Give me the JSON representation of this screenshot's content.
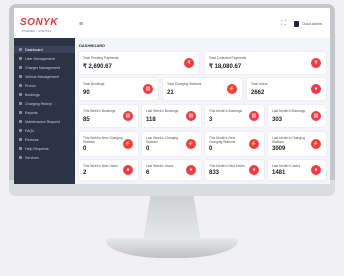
{
  "app": {
    "logo": "SONYK",
    "logo_sub": "POWER · DIGITAL",
    "user_menu": "Cloud Admin"
  },
  "sidebar": {
    "items": [
      {
        "label": "Dashboard",
        "active": true
      },
      {
        "label": "User Management"
      },
      {
        "label": "Charger Management"
      },
      {
        "label": "Vehicle Management"
      },
      {
        "label": "Promo"
      },
      {
        "label": "Bookings"
      },
      {
        "label": "Charging History"
      },
      {
        "label": "Reports"
      },
      {
        "label": "Maintenance Request"
      },
      {
        "label": "FAQs"
      },
      {
        "label": "Reviews"
      },
      {
        "label": "Help Requests"
      },
      {
        "label": "Services"
      }
    ]
  },
  "main": {
    "title": "DASHBOARD"
  },
  "stats": {
    "row1": [
      {
        "label": "Total Pending Payments",
        "value": "₹ 2,690.67"
      },
      {
        "label": "Total Collected Payments",
        "value": "₹ 18,080.67"
      }
    ],
    "row2": [
      {
        "label": "Total Bookings",
        "value": "90"
      },
      {
        "label": "Total Charging Stations",
        "value": "21"
      },
      {
        "label": "Total Users",
        "value": "2662"
      }
    ],
    "row3": [
      {
        "label": "This Week's Bookings",
        "value": "85"
      },
      {
        "label": "Last Week's Bookings",
        "value": "118"
      },
      {
        "label": "This Month's Bookings",
        "value": "3"
      },
      {
        "label": "Last Month's Bookings",
        "value": "303"
      }
    ],
    "row4": [
      {
        "label": "This Week's New Charging Stations",
        "value": "0"
      },
      {
        "label": "Last Week's Charging Stations",
        "value": "0"
      },
      {
        "label": "This Month's New Charging Stations",
        "value": "0"
      },
      {
        "label": "Last Month's Charging Stations",
        "value": "3009"
      }
    ],
    "row5": [
      {
        "label": "This Week's New Users",
        "value": "2"
      },
      {
        "label": "Last Week's Users",
        "value": "6"
      },
      {
        "label": "This Month's New Users",
        "value": "833"
      },
      {
        "label": "Last Month's Users",
        "value": "1481"
      }
    ]
  },
  "colors": {
    "accent": "#ef3d47",
    "sidebar": "#2b3344"
  }
}
